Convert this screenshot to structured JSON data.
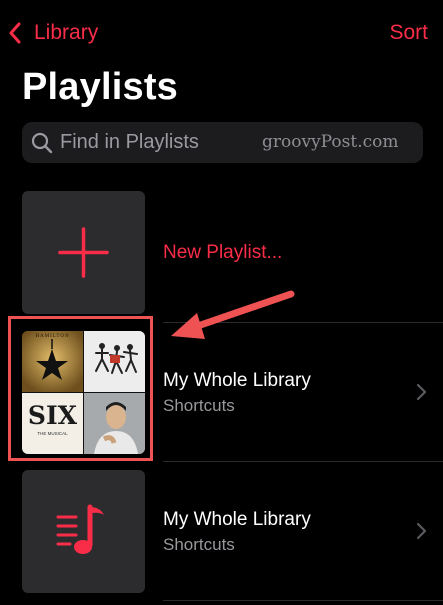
{
  "colors": {
    "accent": "#fa2d48",
    "secondary_text": "#98989d",
    "annotation": "#ee5253"
  },
  "nav": {
    "back_label": "Library",
    "right_label": "Sort"
  },
  "title": "Playlists",
  "search": {
    "placeholder": "Find in Playlists"
  },
  "watermark": "groovyPost.com",
  "new_playlist": {
    "label": "New Playlist..."
  },
  "playlists": [
    {
      "title": "My Whole Library",
      "subtitle": "Shortcuts",
      "artwork": "album-mosaic"
    },
    {
      "title": "My Whole Library",
      "subtitle": "Shortcuts",
      "artwork": "music-list-icon"
    }
  ],
  "artwork_text": {
    "top_left": "HAMILTON",
    "bottom_left": "SIX",
    "bottom_left_sub": "THE MUSICAL"
  }
}
